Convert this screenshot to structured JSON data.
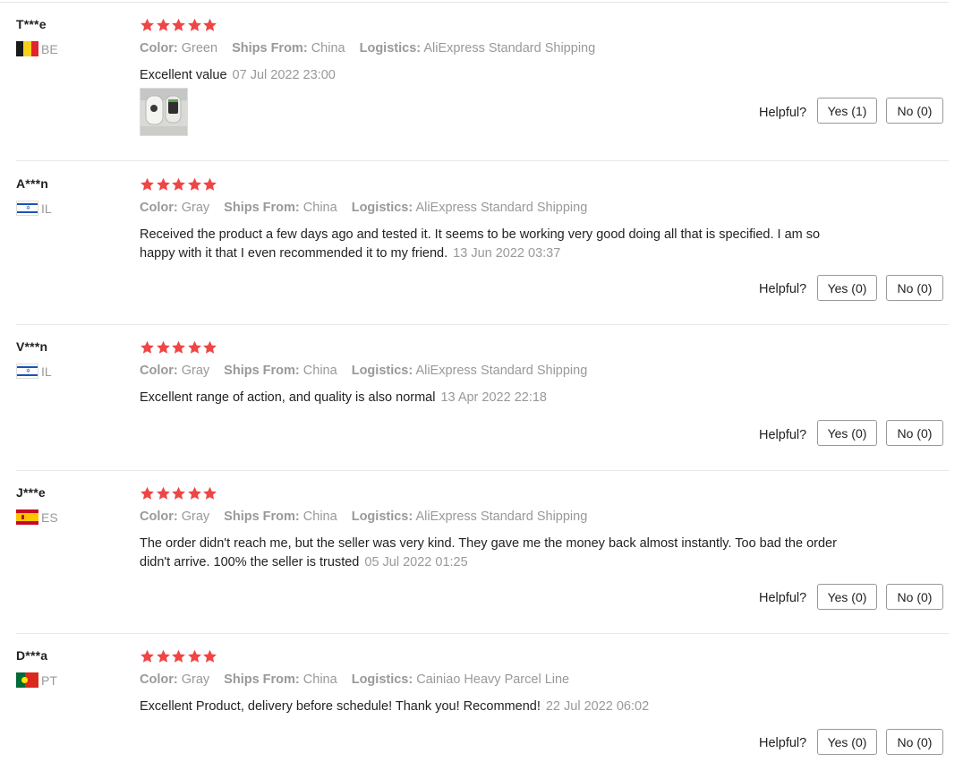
{
  "colors": {
    "star": "#f04545",
    "muted": "#999999",
    "divider": "#e8e8e8"
  },
  "labels": {
    "color": "Color:",
    "ships_from": "Ships From:",
    "logistics": "Logistics:",
    "helpful": "Helpful?"
  },
  "reviews": [
    {
      "user": "T***e",
      "country": "BE",
      "rating": 5,
      "color": "Green",
      "ships_from": "China",
      "logistics": "AliExpress Standard Shipping",
      "text": "Excellent value",
      "date": "07 Jul 2022 23:00",
      "has_photo": true,
      "yes": "Yes (1)",
      "no": "No (0)"
    },
    {
      "user": "A***n",
      "country": "IL",
      "rating": 5,
      "color": "Gray",
      "ships_from": "China",
      "logistics": "AliExpress Standard Shipping",
      "text": "Received the product a few days ago and tested it. It seems to be working very good doing all that is specified. I am so happy with it that I even recommended it to my friend.",
      "date": "13 Jun 2022 03:37",
      "has_photo": false,
      "yes": "Yes (0)",
      "no": "No (0)"
    },
    {
      "user": "V***n",
      "country": "IL",
      "rating": 5,
      "color": "Gray",
      "ships_from": "China",
      "logistics": "AliExpress Standard Shipping",
      "text": "Excellent range of action, and quality is also normal",
      "date": "13 Apr 2022 22:18",
      "has_photo": false,
      "yes": "Yes (0)",
      "no": "No (0)"
    },
    {
      "user": "J***e",
      "country": "ES",
      "rating": 5,
      "color": "Gray",
      "ships_from": "China",
      "logistics": "AliExpress Standard Shipping",
      "text": "The order didn't reach me, but the seller was very kind. They gave me the money back almost instantly. Too bad the order didn't arrive. 100% the seller is trusted",
      "date": "05 Jul 2022 01:25",
      "has_photo": false,
      "yes": "Yes (0)",
      "no": "No (0)"
    },
    {
      "user": "D***a",
      "country": "PT",
      "rating": 5,
      "color": "Gray",
      "ships_from": "China",
      "logistics": "Cainiao Heavy Parcel Line",
      "text": "Excellent Product, delivery before schedule! Thank you! Recommend!",
      "date": "22 Jul 2022 06:02",
      "has_photo": false,
      "yes": "Yes (0)",
      "no": "No (0)"
    }
  ]
}
